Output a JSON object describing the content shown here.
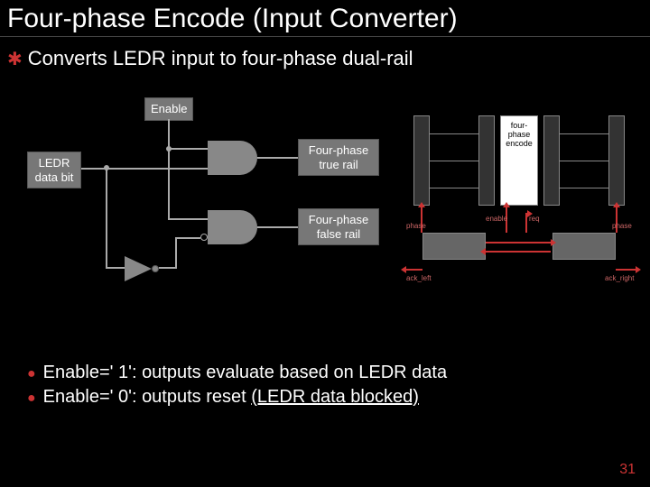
{
  "title": "Four-phase Encode (Input Converter)",
  "subtitle": "Converts LEDR input to four-phase dual-rail",
  "circuit": {
    "ledr_label": "LEDR\ndata bit",
    "enable_label": "Enable",
    "true_rail_label": "Four-phase\ntrue rail",
    "false_rail_label": "Four-phase\nfalse rail"
  },
  "pipeline": {
    "encode_label": "four-\nphase\nencode",
    "phase_left": "phase",
    "phase_right": "phase",
    "ack_left": "ack_left",
    "ack_right": "ack_right",
    "enable_center": "enable",
    "req_center": "req"
  },
  "bullets": [
    {
      "prefix": "Enable=' 1': ",
      "text": "outputs evaluate based on LEDR data"
    },
    {
      "prefix": "Enable=' 0': ",
      "text_pre": "outputs reset ",
      "underlined": "(LEDR data blocked)"
    }
  ],
  "page_number": "31"
}
